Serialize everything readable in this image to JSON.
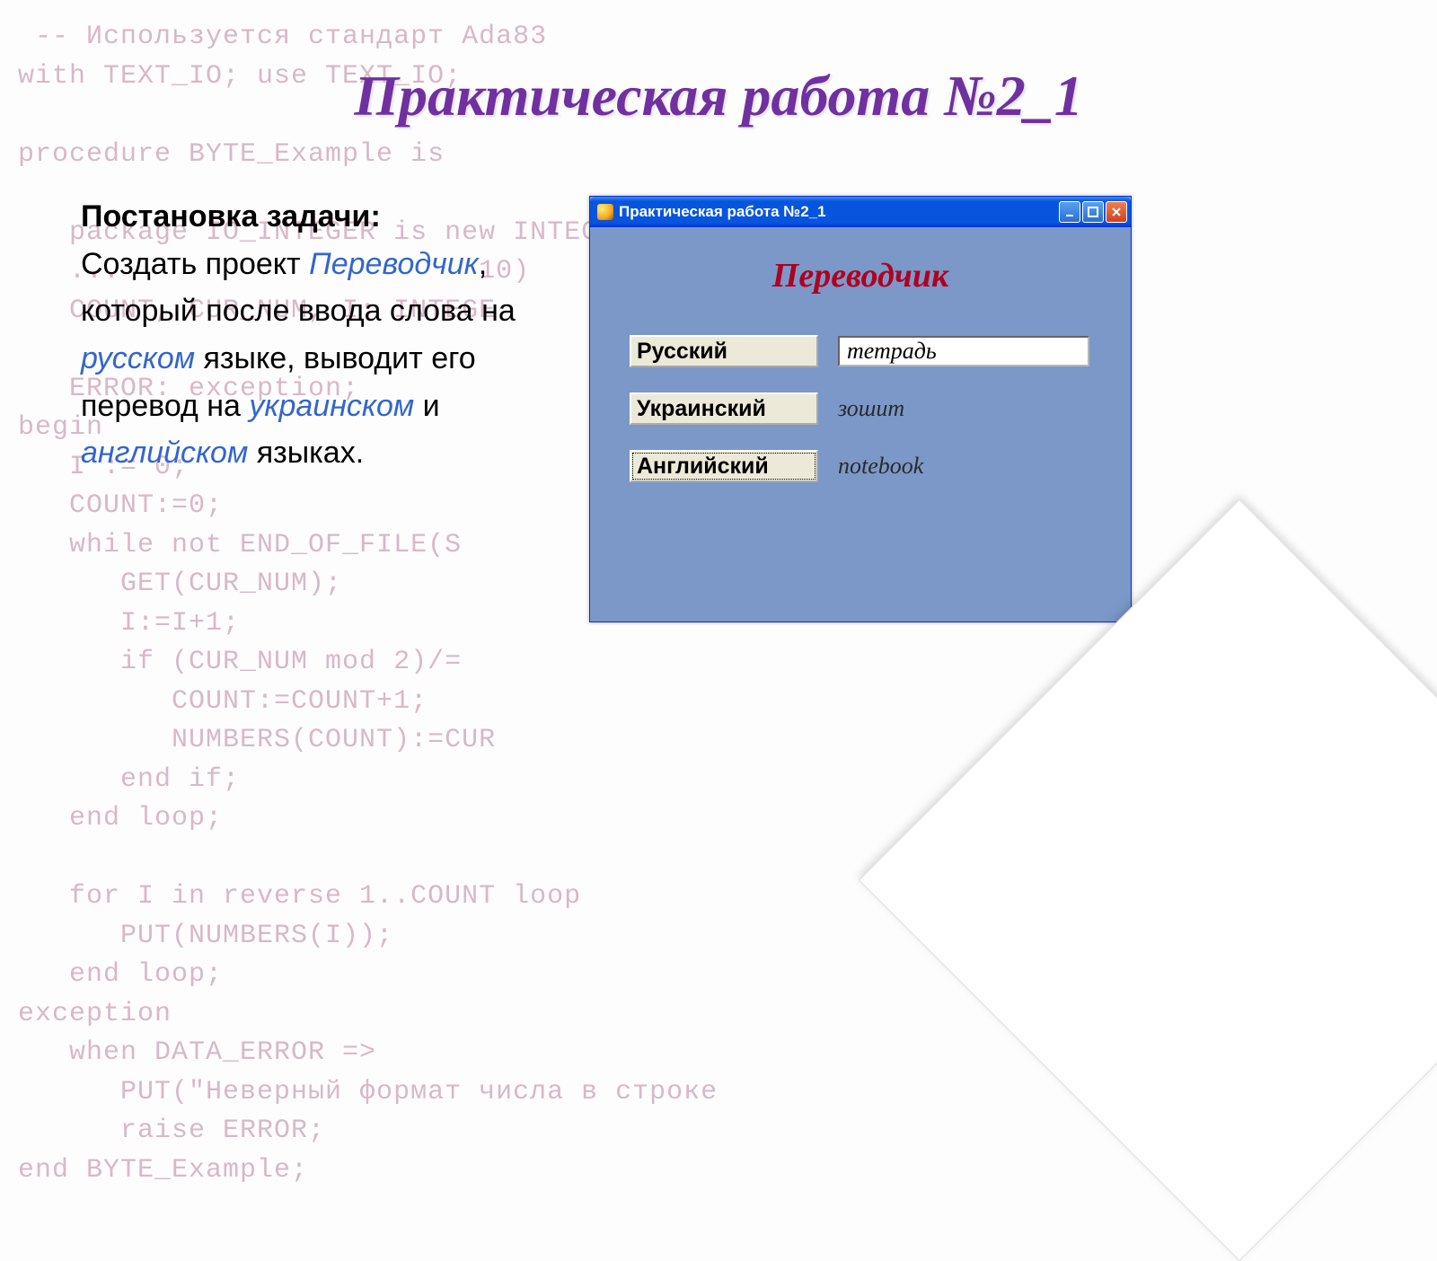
{
  "slide": {
    "title": "Практическая работа №2_1"
  },
  "bg_code": " -- Используется стандарт Ada83\nwith TEXT_IO; use TEXT_IO;\n\nprocedure BYTE_Example is\n\n   package IO_INTEGER is new INTEGER_IO(INTEGER);\n   ...                     10)\n   COUNT, CUR_NUM, I: INTEGE\n\n   ERROR: exception;\nbegin\n   I := 0;\n   COUNT:=0;\n   while not END_OF_FILE(S                              oop\n      GET(CUR_NUM);\n      I:=I+1;\n      if (CUR_NUM mod 2)/=\n         COUNT:=COUNT+1;\n         NUMBERS(COUNT):=CUR\n      end if;\n   end loop;\n\n   for I in reverse 1..COUNT loop\n      PUT(NUMBERS(I));\n   end loop;\nexception\n   when DATA_ERROR =>\n      PUT(\"Неверный формат числа в строке\n      raise ERROR;\nend BYTE_Example;",
  "task": {
    "heading": "Постановка задачи:",
    "line1_a": "Создать проект ",
    "line1_b": "Переводчик",
    "line1_c": ", который после ввода слова на ",
    "line1_d": "русском",
    "line1_e": " языке, выводит его перевод на ",
    "line1_f": "украинском",
    "line1_g": " и ",
    "line1_h": "английском",
    "line1_i": " языках."
  },
  "window": {
    "title": "Практическая работа №2_1",
    "app_heading": "Переводчик",
    "rows": {
      "russian": {
        "label": "Русский",
        "value": "тетрадь"
      },
      "ukrainian": {
        "label": "Украинский",
        "value": "зошит"
      },
      "english": {
        "label": "Английский",
        "value": "notebook"
      }
    }
  }
}
